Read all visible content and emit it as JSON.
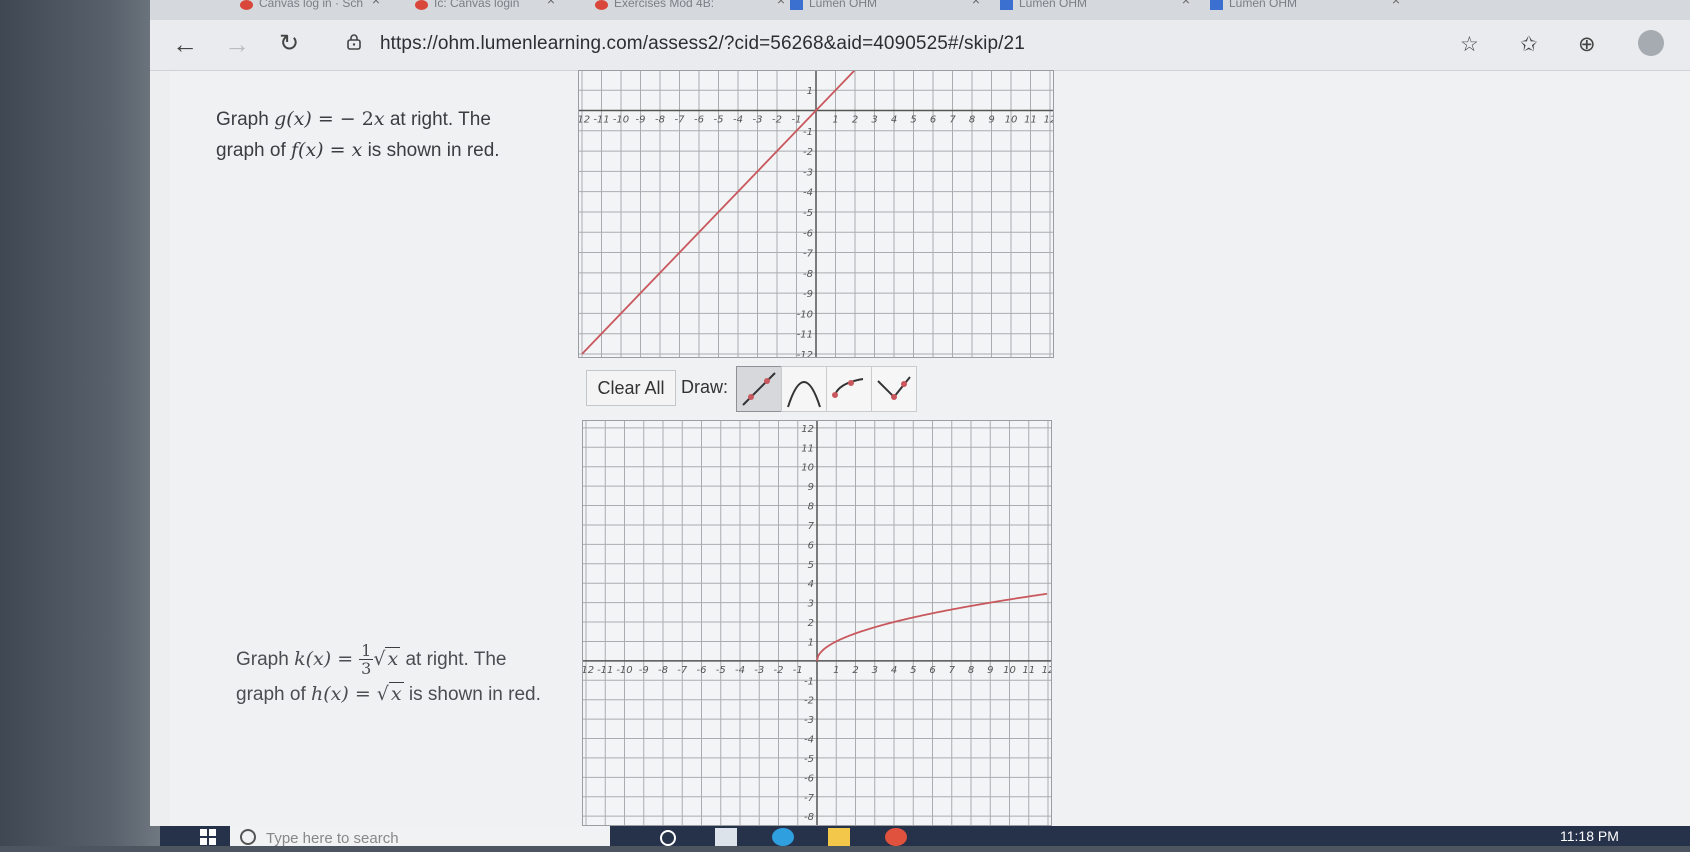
{
  "browser": {
    "tabs": [
      {
        "title": "Canvas log in · Sch",
        "favicon": "red-circle"
      },
      {
        "title": "Ic: Canvas login",
        "favicon": "red-circle"
      },
      {
        "title": "Exercises Mod 4B:",
        "favicon": "red-circle"
      },
      {
        "title": "Lumen OHM",
        "favicon": "blue-square"
      },
      {
        "title": "Lumen OHM",
        "favicon": "blue-square"
      },
      {
        "title": "Lumen OHM",
        "favicon": "blue-square"
      }
    ],
    "url": "https://ohm.lumenlearning.com/assess2/?cid=56268&aid=4090525#/skip/21"
  },
  "question1": {
    "line1_prefix": "Graph ",
    "func": "g(x)",
    "eq": " = − 2",
    "var": "x",
    "line1_suffix": " at right. The",
    "line2_prefix": "graph of ",
    "func2": "f(x)",
    "eq2": " = ",
    "var2": "x",
    "line2_suffix": " is shown in red."
  },
  "question2": {
    "line1_prefix": "Graph ",
    "func": "k(x)",
    "eq": " = ",
    "frac_num": "1",
    "frac_den": "3",
    "sqrt_sym": "√",
    "sqrt_var": "x",
    "line1_suffix": " at right. The",
    "line2_prefix": "graph of ",
    "func2": "h(x)",
    "eq2": " = ",
    "sqrt2_var": "x",
    "line2_suffix": " is shown in red."
  },
  "controls": {
    "clear_label": "Clear All",
    "draw_label": "Draw:",
    "tools": [
      "line-tool",
      "parabola-tool",
      "sqrt-tool",
      "abs-value-tool"
    ]
  },
  "graph1": {
    "x_ticks": [
      -12,
      -11,
      -10,
      -9,
      -8,
      -7,
      -6,
      -5,
      -4,
      -3,
      -2,
      -1,
      1,
      2,
      3,
      4,
      5,
      6,
      7,
      8,
      9,
      10,
      11,
      12
    ],
    "y_ticks_visible": [
      1,
      -1,
      -2,
      -3,
      -4,
      -5,
      -6,
      -7,
      -8,
      -9,
      -10,
      -11,
      -12
    ],
    "x_range": [
      -12,
      12
    ],
    "y_range": [
      -12,
      1.8
    ],
    "red_curve": "y = x",
    "color": "#c9585e"
  },
  "graph2": {
    "x_ticks": [
      -12,
      -11,
      -10,
      -9,
      -8,
      -7,
      -6,
      -5,
      -4,
      -3,
      -2,
      -1,
      1,
      2,
      3,
      4,
      5,
      6,
      7,
      8,
      9,
      10,
      11,
      12
    ],
    "y_ticks_visible": [
      12,
      11,
      10,
      9,
      8,
      7,
      6,
      5,
      4,
      3,
      2,
      1,
      -1,
      -2,
      -3,
      -4,
      -5,
      -6,
      -7,
      -8
    ],
    "x_range": [
      -12,
      12
    ],
    "y_range": [
      -8.3,
      12.2
    ],
    "red_curve": "y = sqrt(x)",
    "color": "#c9585e"
  },
  "taskbar": {
    "search_placeholder": "Type here to search",
    "clock": "11:18 PM"
  }
}
